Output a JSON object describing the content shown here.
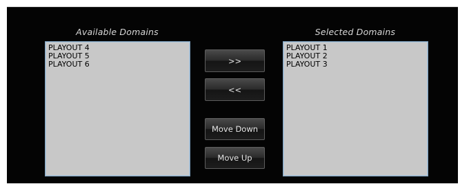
{
  "available": {
    "title": "Available Domains",
    "items": [
      "PLAYOUT 4",
      "PLAYOUT 5",
      "PLAYOUT 6"
    ]
  },
  "selected": {
    "title": "Selected Domains",
    "items": [
      "PLAYOUT 1",
      "PLAYOUT 2",
      "PLAYOUT 3"
    ]
  },
  "buttons": {
    "add_label": ">>",
    "remove_label": "<<",
    "move_down_label": "Move Down",
    "move_up_label": "Move Up"
  },
  "colors": {
    "panel_bg": "#040404",
    "list_bg": "#c8c8c8",
    "list_border": "#7fa2c0",
    "title_text": "#d8d8d8",
    "button_text": "#e6e6e6"
  }
}
